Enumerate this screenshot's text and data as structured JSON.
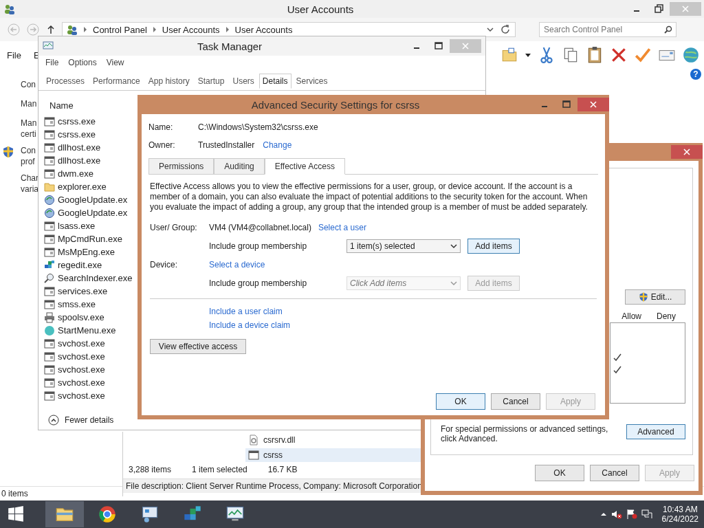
{
  "control_panel": {
    "title": "User Accounts",
    "breadcrumb": [
      "Control Panel",
      "User Accounts",
      "User Accounts"
    ],
    "search": {
      "placeholder": "Search Control Panel"
    },
    "menu": [
      "File",
      "E"
    ],
    "nav_items": [
      {
        "kind": "text",
        "lines": [
          "Con"
        ]
      },
      {
        "kind": "text",
        "lines": [
          "Man"
        ]
      },
      {
        "kind": "text",
        "lines": [
          "Man",
          "certi"
        ]
      },
      {
        "kind": "shield",
        "lines": [
          "Con",
          "prof"
        ]
      },
      {
        "kind": "text",
        "lines": [
          "Char",
          "varia"
        ]
      }
    ],
    "help_icon": "?",
    "status": "0 items"
  },
  "task_manager": {
    "title": "Task Manager",
    "menu": [
      "File",
      "Options",
      "View"
    ],
    "tabs": [
      {
        "label": "Processes",
        "selected": false
      },
      {
        "label": "Performance",
        "selected": false
      },
      {
        "label": "App history",
        "selected": false
      },
      {
        "label": "Startup",
        "selected": false
      },
      {
        "label": "Users",
        "selected": false
      },
      {
        "label": "Details",
        "selected": true
      },
      {
        "label": "Services",
        "selected": false
      }
    ],
    "column": "Name",
    "processes": [
      {
        "name": "csrss.exe",
        "kind": "app"
      },
      {
        "name": "csrss.exe",
        "kind": "app"
      },
      {
        "name": "dllhost.exe",
        "kind": "app"
      },
      {
        "name": "dllhost.exe",
        "kind": "app"
      },
      {
        "name": "dwm.exe",
        "kind": "app"
      },
      {
        "name": "explorer.exe",
        "kind": "folder"
      },
      {
        "name": "GoogleUpdate.ex",
        "kind": "update"
      },
      {
        "name": "GoogleUpdate.ex",
        "kind": "update"
      },
      {
        "name": "lsass.exe",
        "kind": "app"
      },
      {
        "name": "MpCmdRun.exe",
        "kind": "app"
      },
      {
        "name": "MsMpEng.exe",
        "kind": "app"
      },
      {
        "name": "regedit.exe",
        "kind": "registry"
      },
      {
        "name": "SearchIndexer.exe",
        "kind": "search"
      },
      {
        "name": "services.exe",
        "kind": "app"
      },
      {
        "name": "smss.exe",
        "kind": "app"
      },
      {
        "name": "spoolsv.exe",
        "kind": "printer"
      },
      {
        "name": "StartMenu.exe",
        "kind": "orb"
      },
      {
        "name": "svchost.exe",
        "kind": "app"
      },
      {
        "name": "svchost.exe",
        "kind": "app"
      },
      {
        "name": "svchost.exe",
        "kind": "app"
      },
      {
        "name": "svchost.exe",
        "kind": "app"
      },
      {
        "name": "svchost.exe",
        "kind": "app"
      }
    ],
    "footer": "Fewer details"
  },
  "explorer": {
    "files": [
      {
        "name": "csrsrv.dll",
        "kind": "dll",
        "selected": false
      },
      {
        "name": "csrss",
        "kind": "app",
        "selected": true
      }
    ],
    "item_count": "3,288 items",
    "selection": "1 item selected",
    "size": "16.7 KB",
    "file_description": "File description: Client Server Runtime Process, Company: Microsoft Corporation"
  },
  "advanced_security": {
    "title": "Advanced Security Settings for csrss",
    "name_label": "Name:",
    "name": "C:\\Windows\\System32\\csrss.exe",
    "owner_label": "Owner:",
    "owner": "TrustedInstaller",
    "change_link": "Change",
    "tabs": [
      {
        "label": "Permissions",
        "selected": false
      },
      {
        "label": "Auditing",
        "selected": false
      },
      {
        "label": "Effective Access",
        "selected": true
      }
    ],
    "description": "Effective Access allows you to view the effective permissions for a user, group, or device account. If the account is a member of a domain, you can also evaluate the impact of potential additions to the security token for the account. When you evaluate the impact of adding a group, any group that the intended group is a member of must be added separately.",
    "user_group_label": "User/ Group:",
    "user": "VM4 (VM4@collabnet.local)",
    "select_user": "Select a user",
    "include_user": {
      "label": "Include group membership",
      "value": "1 item(s) selected",
      "disabled": false
    },
    "add_user": {
      "label": "Add items",
      "disabled": false
    },
    "device_label": "Device:",
    "select_device": "Select a device",
    "include_device": {
      "label": "Include group membership",
      "placeholder": "Click Add items",
      "disabled": true
    },
    "add_device": {
      "label": "Add items",
      "disabled": true
    },
    "claims": [
      "Include a user claim",
      "Include a device claim"
    ],
    "view_button": "View effective access",
    "buttons": [
      {
        "label": "OK",
        "disabled": false
      },
      {
        "label": "Cancel",
        "disabled": false
      },
      {
        "label": "Apply",
        "disabled": true
      }
    ]
  },
  "properties": {
    "edit_button": "Edit...",
    "allow_header": "Allow",
    "deny_header": "Deny",
    "permissions": [
      {
        "allow": false
      },
      {
        "allow": false
      },
      {
        "allow": true
      },
      {
        "allow": true
      },
      {
        "allow": false
      },
      {
        "allow": false
      }
    ],
    "advanced_note": "For special permissions or advanced settings, click Advanced.",
    "advanced_button": "Advanced",
    "buttons": [
      {
        "label": "OK",
        "disabled": false
      },
      {
        "label": "Cancel",
        "disabled": false
      },
      {
        "label": "Apply",
        "disabled": true
      }
    ]
  },
  "taskbar": {
    "time": "10:43 AM",
    "date": "6/24/2022"
  }
}
